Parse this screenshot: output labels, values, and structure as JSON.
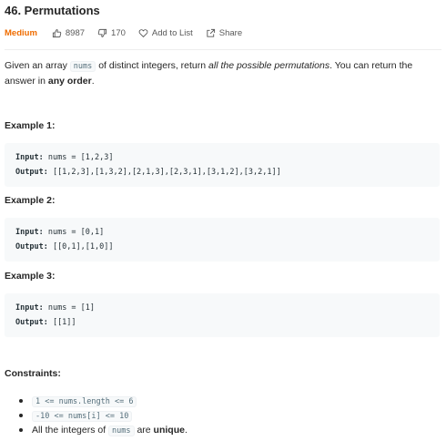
{
  "problem": {
    "title": "46. Permutations",
    "difficulty": "Medium",
    "likes": "8987",
    "dislikes": "170",
    "add_to_list": "Add to List",
    "share": "Share"
  },
  "description": {
    "part1": "Given an array ",
    "code1": "nums",
    "part2": " of distinct integers, return ",
    "emph": "all the possible permutations",
    "part3": ". You can return the answer in ",
    "strong": "any order",
    "part4": "."
  },
  "examples": [
    {
      "heading": "Example 1:",
      "input_label": "Input:",
      "input_value": " nums = [1,2,3]",
      "output_label": "Output:",
      "output_value": " [[1,2,3],[1,3,2],[2,1,3],[2,3,1],[3,1,2],[3,2,1]]"
    },
    {
      "heading": "Example 2:",
      "input_label": "Input:",
      "input_value": " nums = [0,1]",
      "output_label": "Output:",
      "output_value": " [[0,1],[1,0]]"
    },
    {
      "heading": "Example 3:",
      "input_label": "Input:",
      "input_value": " nums = [1]",
      "output_label": "Output:",
      "output_value": " [[1]]"
    }
  ],
  "constraints": {
    "heading": "Constraints:",
    "c1": "1 <= nums.length <= 6",
    "c2": "-10 <= nums[i] <= 10",
    "c3_pre": "All the integers of ",
    "c3_code": "nums",
    "c3_mid": " are ",
    "c3_strong": "unique",
    "c3_post": "."
  },
  "colors": {
    "difficulty_medium": "#ef6c00",
    "code_bg": "#f7f9fa"
  },
  "icons": [
    "thumbs-up-icon",
    "thumbs-down-icon",
    "heart-icon",
    "share-icon"
  ]
}
